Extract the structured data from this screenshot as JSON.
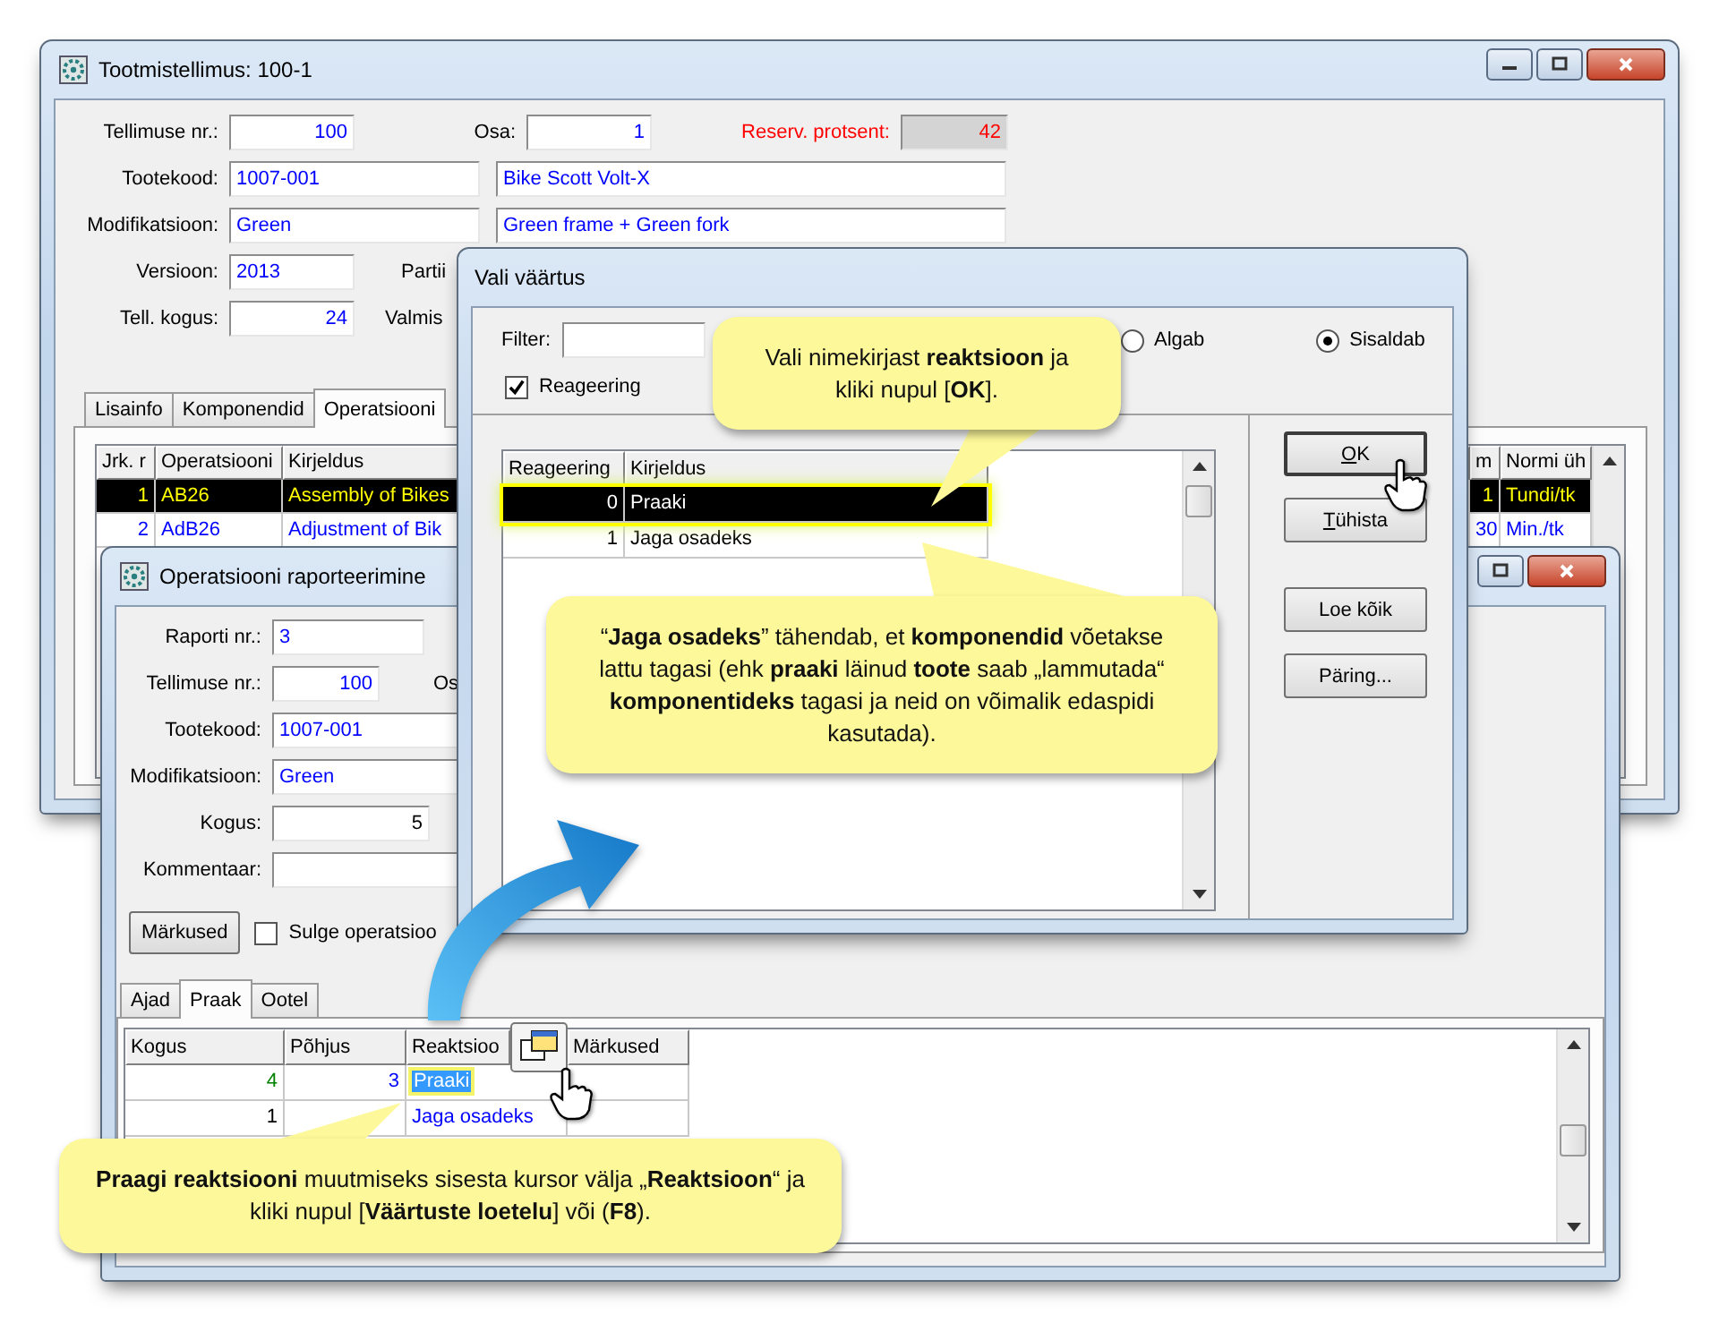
{
  "main_window": {
    "title": "Tootmistellimus: 100-1",
    "fields": [
      {
        "label": "Tellimuse nr.:",
        "value": "100",
        "warning": false
      },
      {
        "label": "Osa:",
        "value": "1",
        "warning": false
      },
      {
        "label": "Reserv. protsent:",
        "value": "42",
        "warning": true
      },
      {
        "label": "Tootekood:",
        "value": "1007-001"
      },
      {
        "value": "Bike Scott Volt-X"
      },
      {
        "label": "Modifikatsioon:",
        "value": "Green"
      },
      {
        "value": "Green frame + Green fork"
      },
      {
        "label": "Versioon:",
        "value": "2013"
      },
      {
        "label": "Partii"
      },
      {
        "label": "Tell. kogus:",
        "value": "24"
      },
      {
        "label": "Valmis"
      }
    ],
    "tabs": [
      {
        "label": "Lisainfo",
        "selected": false
      },
      {
        "label": "Komponendid",
        "selected": false
      },
      {
        "label": "Operatsiooni",
        "selected": true
      }
    ],
    "table": {
      "columns": [
        "Jrk. r",
        "Operatsiooni",
        "Kirjeldus",
        "m",
        "Normi üh"
      ],
      "rows": [
        {
          "cells": [
            "1",
            "AB26",
            "Assembly of Bikes",
            "1",
            "Tundi/tk"
          ],
          "selected": true
        },
        {
          "cells": [
            "2",
            "AdB26",
            "Adjustment of Bik",
            "30",
            "Min./tk"
          ],
          "selected": false
        }
      ]
    }
  },
  "report_window": {
    "title": "Operatsiooni raporteerimine",
    "fields": [
      {
        "label": "Raporti nr.:",
        "value": "3",
        "editable": false
      },
      {
        "label": "Tellimuse nr.:",
        "value": "100",
        "editable": false
      },
      {
        "label": "Os"
      },
      {
        "label": "Tootekood:",
        "value": "1007-001",
        "editable": false
      },
      {
        "label": "Modifikatsioon:",
        "value": "Green",
        "editable": false
      },
      {
        "label": "Kogus:",
        "value": "5",
        "editable": true
      },
      {
        "label": "Kommentaar:"
      }
    ],
    "notes_button": "Märkused",
    "close_checkbox": {
      "label": "Sulge operatsioo",
      "checked": false
    },
    "tabs": [
      {
        "label": "Ajad",
        "selected": false
      },
      {
        "label": "Praak",
        "selected": true
      },
      {
        "label": "Ootel",
        "selected": false
      }
    ],
    "table": {
      "columns": [
        "Kogus",
        "Põhjus",
        "Reaktsioo",
        "Märkused"
      ],
      "rows": [
        {
          "quantity": "4",
          "color": "#008000",
          "reason": "3",
          "reaction": "Praaki",
          "selected": true
        },
        {
          "quantity": "1",
          "color": "#000000",
          "reaction": "Jaga osadeks",
          "selected": false
        }
      ]
    }
  },
  "dialog": {
    "title": "Vali väärtus",
    "filter_label": "Filter:",
    "radios": [
      {
        "label": "Algab",
        "selected": false
      },
      {
        "label": "Sisaldab",
        "selected": true
      }
    ],
    "checkbox": {
      "label": "Reageering",
      "checked": true
    },
    "list": {
      "columns": [
        "Reageering",
        "Kirjeldus"
      ],
      "rows": [
        {
          "code": "0",
          "text": "Praaki",
          "selected": true
        },
        {
          "code": "1",
          "text": "Jaga osadeks",
          "selected": false
        }
      ]
    },
    "buttons": [
      {
        "label": "OK",
        "underline_first": true
      },
      {
        "label": "Tühista",
        "underline_first": true
      },
      {
        "label": "Loe kõik",
        "underline_first": false
      },
      {
        "label": "Päring...",
        "underline_first": false
      }
    ]
  },
  "callouts": [
    {
      "text": "Vali nimekirjast **reaktsioon** ja kliki nupul [**OK**]."
    },
    {
      "text": "“**Jaga osadeks**” tähendab, et **komponendid** võetakse lattu tagasi (ehk **praaki** läinud **toote** saab „lammutada“ **komponentideks** tagasi ja neid on võimalik edaspidi kasutada)."
    },
    {
      "text": "**Praagi reaktsiooni** muutmiseks sisesta kursor välja „**Reaktsioon**“ ja kliki nupul [**Väärtuste loetelu**] või (**F8**)."
    }
  ]
}
